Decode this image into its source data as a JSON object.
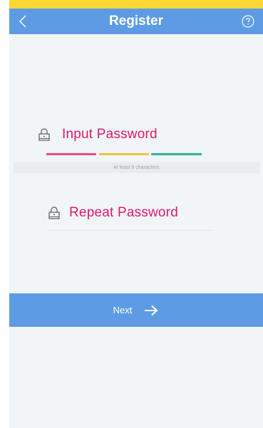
{
  "header": {
    "title": "Register",
    "back_icon": "chevron-left-icon",
    "help_icon": "question-circle-icon"
  },
  "password": {
    "label": "Input Password",
    "hint": "At least 8 characters.",
    "icon": "lock-icon",
    "strength_colors": [
      "#e94b8a",
      "#f2c43c",
      "#27b79a"
    ]
  },
  "repeat_password": {
    "label": "Repeat Password",
    "icon": "lock-icon"
  },
  "next_button": {
    "label": "Next",
    "icon": "arrow-right-icon"
  },
  "colors": {
    "primary": "#5e9be5",
    "accent": "#e0186e",
    "top_strip": "#fdd835",
    "background": "#f1f5f8"
  }
}
